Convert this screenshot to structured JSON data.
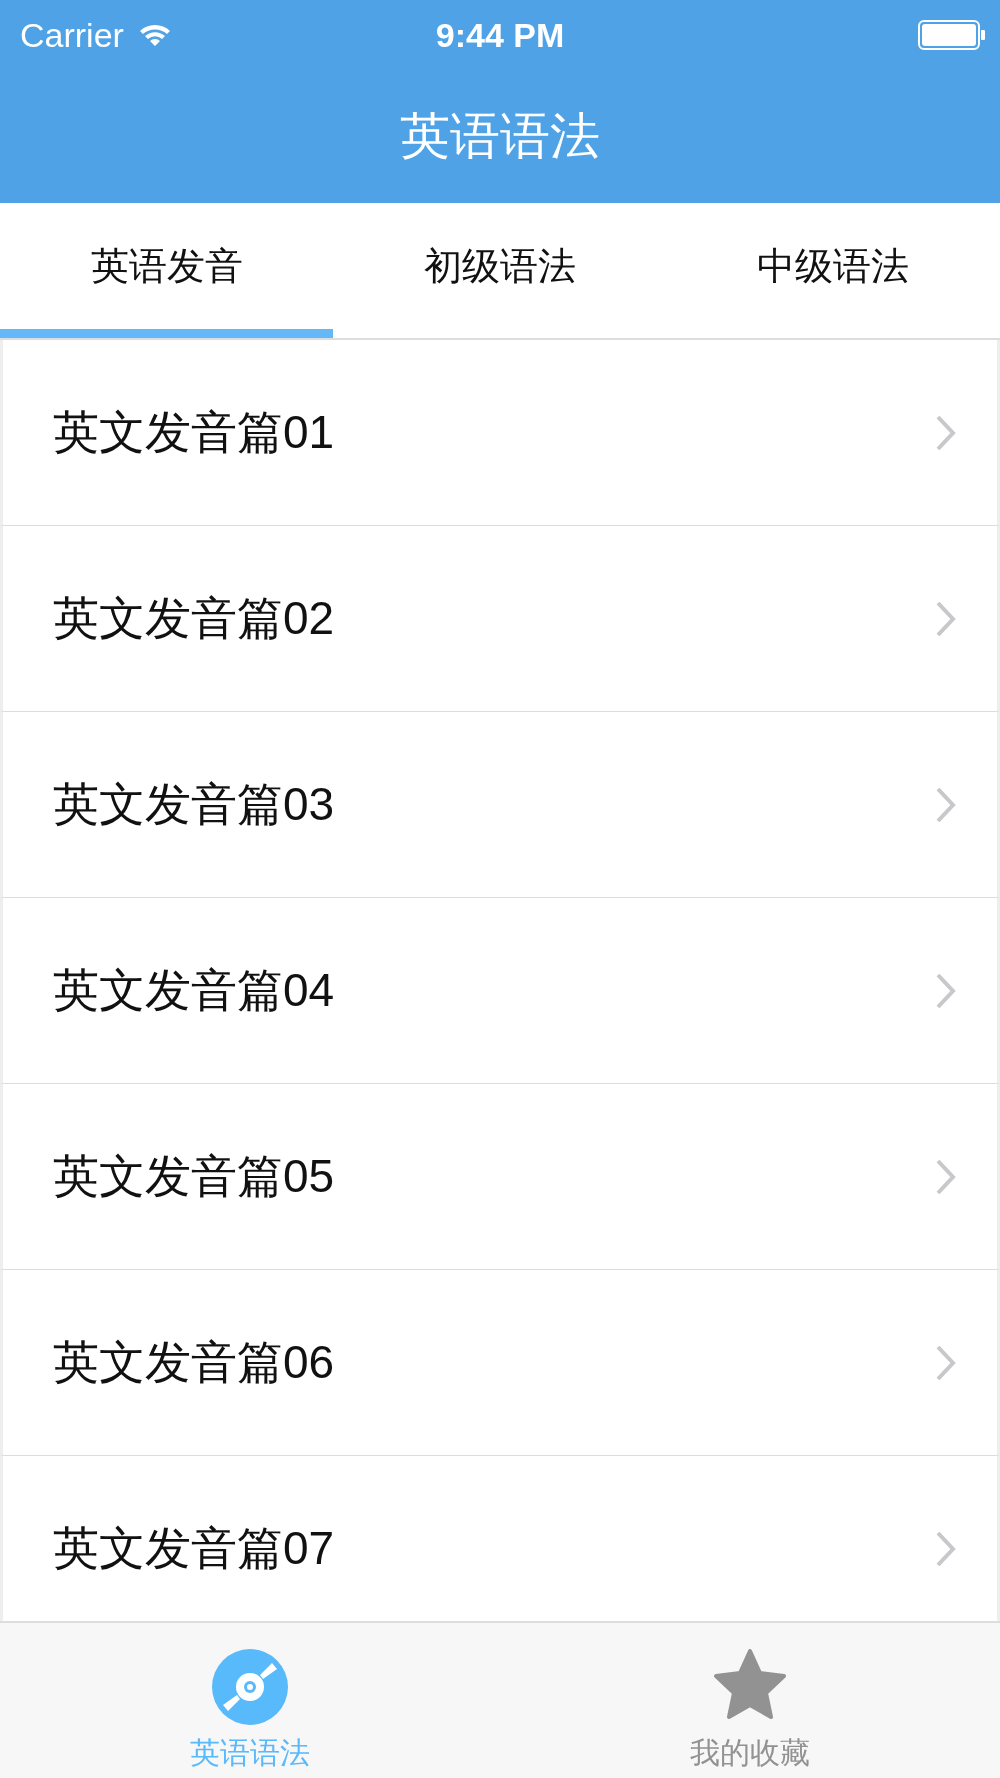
{
  "status_bar": {
    "carrier": "Carrier",
    "time": "9:44 PM"
  },
  "nav_bar": {
    "title": "英语语法"
  },
  "tabs": [
    {
      "label": "英语发音",
      "selected": true
    },
    {
      "label": "初级语法",
      "selected": false
    },
    {
      "label": "中级语法",
      "selected": false
    }
  ],
  "rows": [
    {
      "title": "英文发音篇01"
    },
    {
      "title": "英文发音篇02"
    },
    {
      "title": "英文发音篇03"
    },
    {
      "title": "英文发音篇04"
    },
    {
      "title": "英文发音篇05"
    },
    {
      "title": "英文发音篇06"
    },
    {
      "title": "英文发音篇07"
    }
  ],
  "tab_bar": [
    {
      "label": "英语语法",
      "kind": "disc",
      "selected": true
    },
    {
      "label": "我的收藏",
      "kind": "star",
      "selected": false
    }
  ]
}
